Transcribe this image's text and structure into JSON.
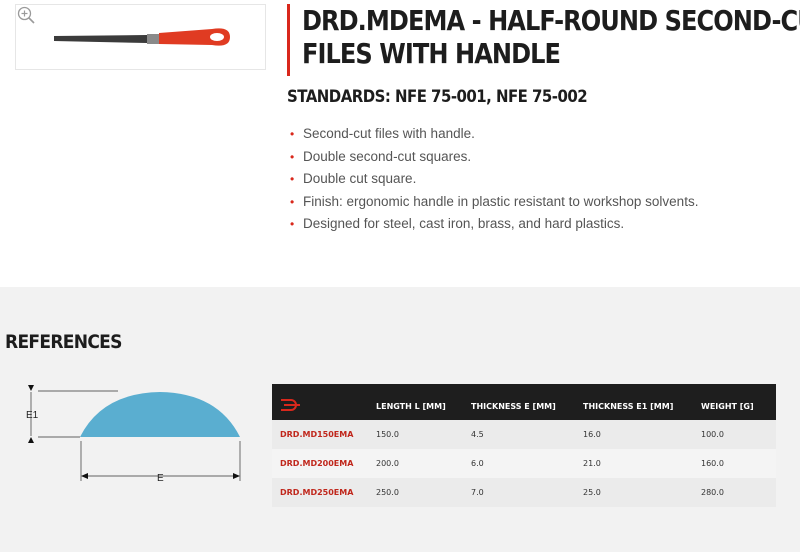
{
  "product": {
    "title_line1": "DRD.MDEMA - HALF-ROUND SECOND-CUT",
    "title_line2": "FILES WITH HANDLE",
    "standards": "STANDARDS: NFE 75-001, NFE 75-002",
    "features": [
      "Second-cut files with handle.",
      "Double second-cut squares.",
      "Double cut square.",
      "Finish: ergonomic handle in plastic resistant to workshop solvents.",
      "Designed for steel, cast iron, brass, and hard plastics."
    ],
    "bullet": "•"
  },
  "references": {
    "heading": "REFERENCES",
    "diagram": {
      "label_e1": "E1",
      "label_e": "E"
    },
    "columns": [
      "LENGTH L [MM]",
      "THICKNESS E [MM]",
      "THICKNESS E1 [MM]",
      "WEIGHT [G]"
    ],
    "rows": [
      {
        "ref": "DRD.MD150EMA",
        "length": "150.0",
        "thickness_e": "4.5",
        "thickness_e1": "16.0",
        "weight": "100.0"
      },
      {
        "ref": "DRD.MD200EMA",
        "length": "200.0",
        "thickness_e": "6.0",
        "thickness_e1": "21.0",
        "weight": "160.0"
      },
      {
        "ref": "DRD.MD250EMA",
        "length": "250.0",
        "thickness_e": "7.0",
        "thickness_e1": "25.0",
        "weight": "280.0"
      }
    ]
  },
  "colors": {
    "accent": "#d9281c",
    "profile_fill": "#5aaed0",
    "table_header": "#1e1e1e"
  },
  "icons": {
    "zoom": "zoom-in-icon",
    "brand": "brand-logo-icon"
  }
}
